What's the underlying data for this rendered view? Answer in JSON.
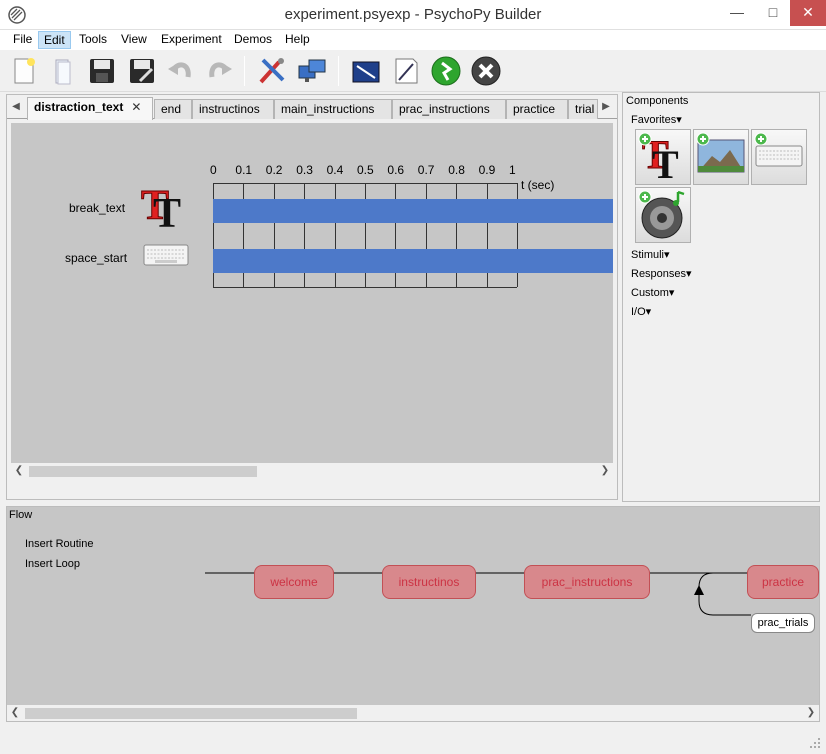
{
  "window": {
    "title": "experiment.psyexp - PsychoPy Builder"
  },
  "menu": [
    "File",
    "Edit",
    "Tools",
    "View",
    "Experiment",
    "Demos",
    "Help"
  ],
  "toolbar": {
    "icons": [
      "new-file-icon",
      "open-file-icon",
      "save-icon",
      "save-as-icon",
      "undo-icon",
      "redo-icon",
      "preferences-icon",
      "monitor-center-icon",
      "experiment-settings-icon",
      "compile-script-icon",
      "run-icon",
      "stop-icon"
    ]
  },
  "routines": {
    "tabs": [
      "distraction_text",
      "end",
      "instructinos",
      "main_instructions",
      "prac_instructions",
      "practice",
      "trial"
    ],
    "active_tab": "distraction_text",
    "close_glyph": "✕",
    "timeline": {
      "ticks": [
        "0",
        "0.1",
        "0.2",
        "0.3",
        "0.4",
        "0.5",
        "0.6",
        "0.7",
        "0.8",
        "0.9",
        "1"
      ],
      "axis_unit": "t (sec)",
      "components": [
        {
          "name": "break_text",
          "icon": "text-icon"
        },
        {
          "name": "space_start",
          "icon": "keyboard-icon"
        }
      ]
    }
  },
  "components_panel": {
    "title": "Components",
    "favorites_label": "Favorites▾",
    "favorites": [
      "text-icon",
      "image-icon",
      "keyboard-icon",
      "sound-icon"
    ],
    "categories": [
      "Stimuli▾",
      "Responses▾",
      "Custom▾",
      "I/O▾"
    ]
  },
  "flow": {
    "title": "Flow",
    "insert_routine": "Insert Routine",
    "insert_loop": "Insert Loop",
    "routines": [
      "welcome",
      "instructinos",
      "prac_instructions",
      "practice"
    ],
    "loop_name": "prac_trials"
  },
  "colors": {
    "timeline_bar": "#4d79c9",
    "flow_routine_fill": "#d8888c",
    "flow_routine_text": "#cc3344",
    "canvas_bg": "#c6c6c6"
  }
}
